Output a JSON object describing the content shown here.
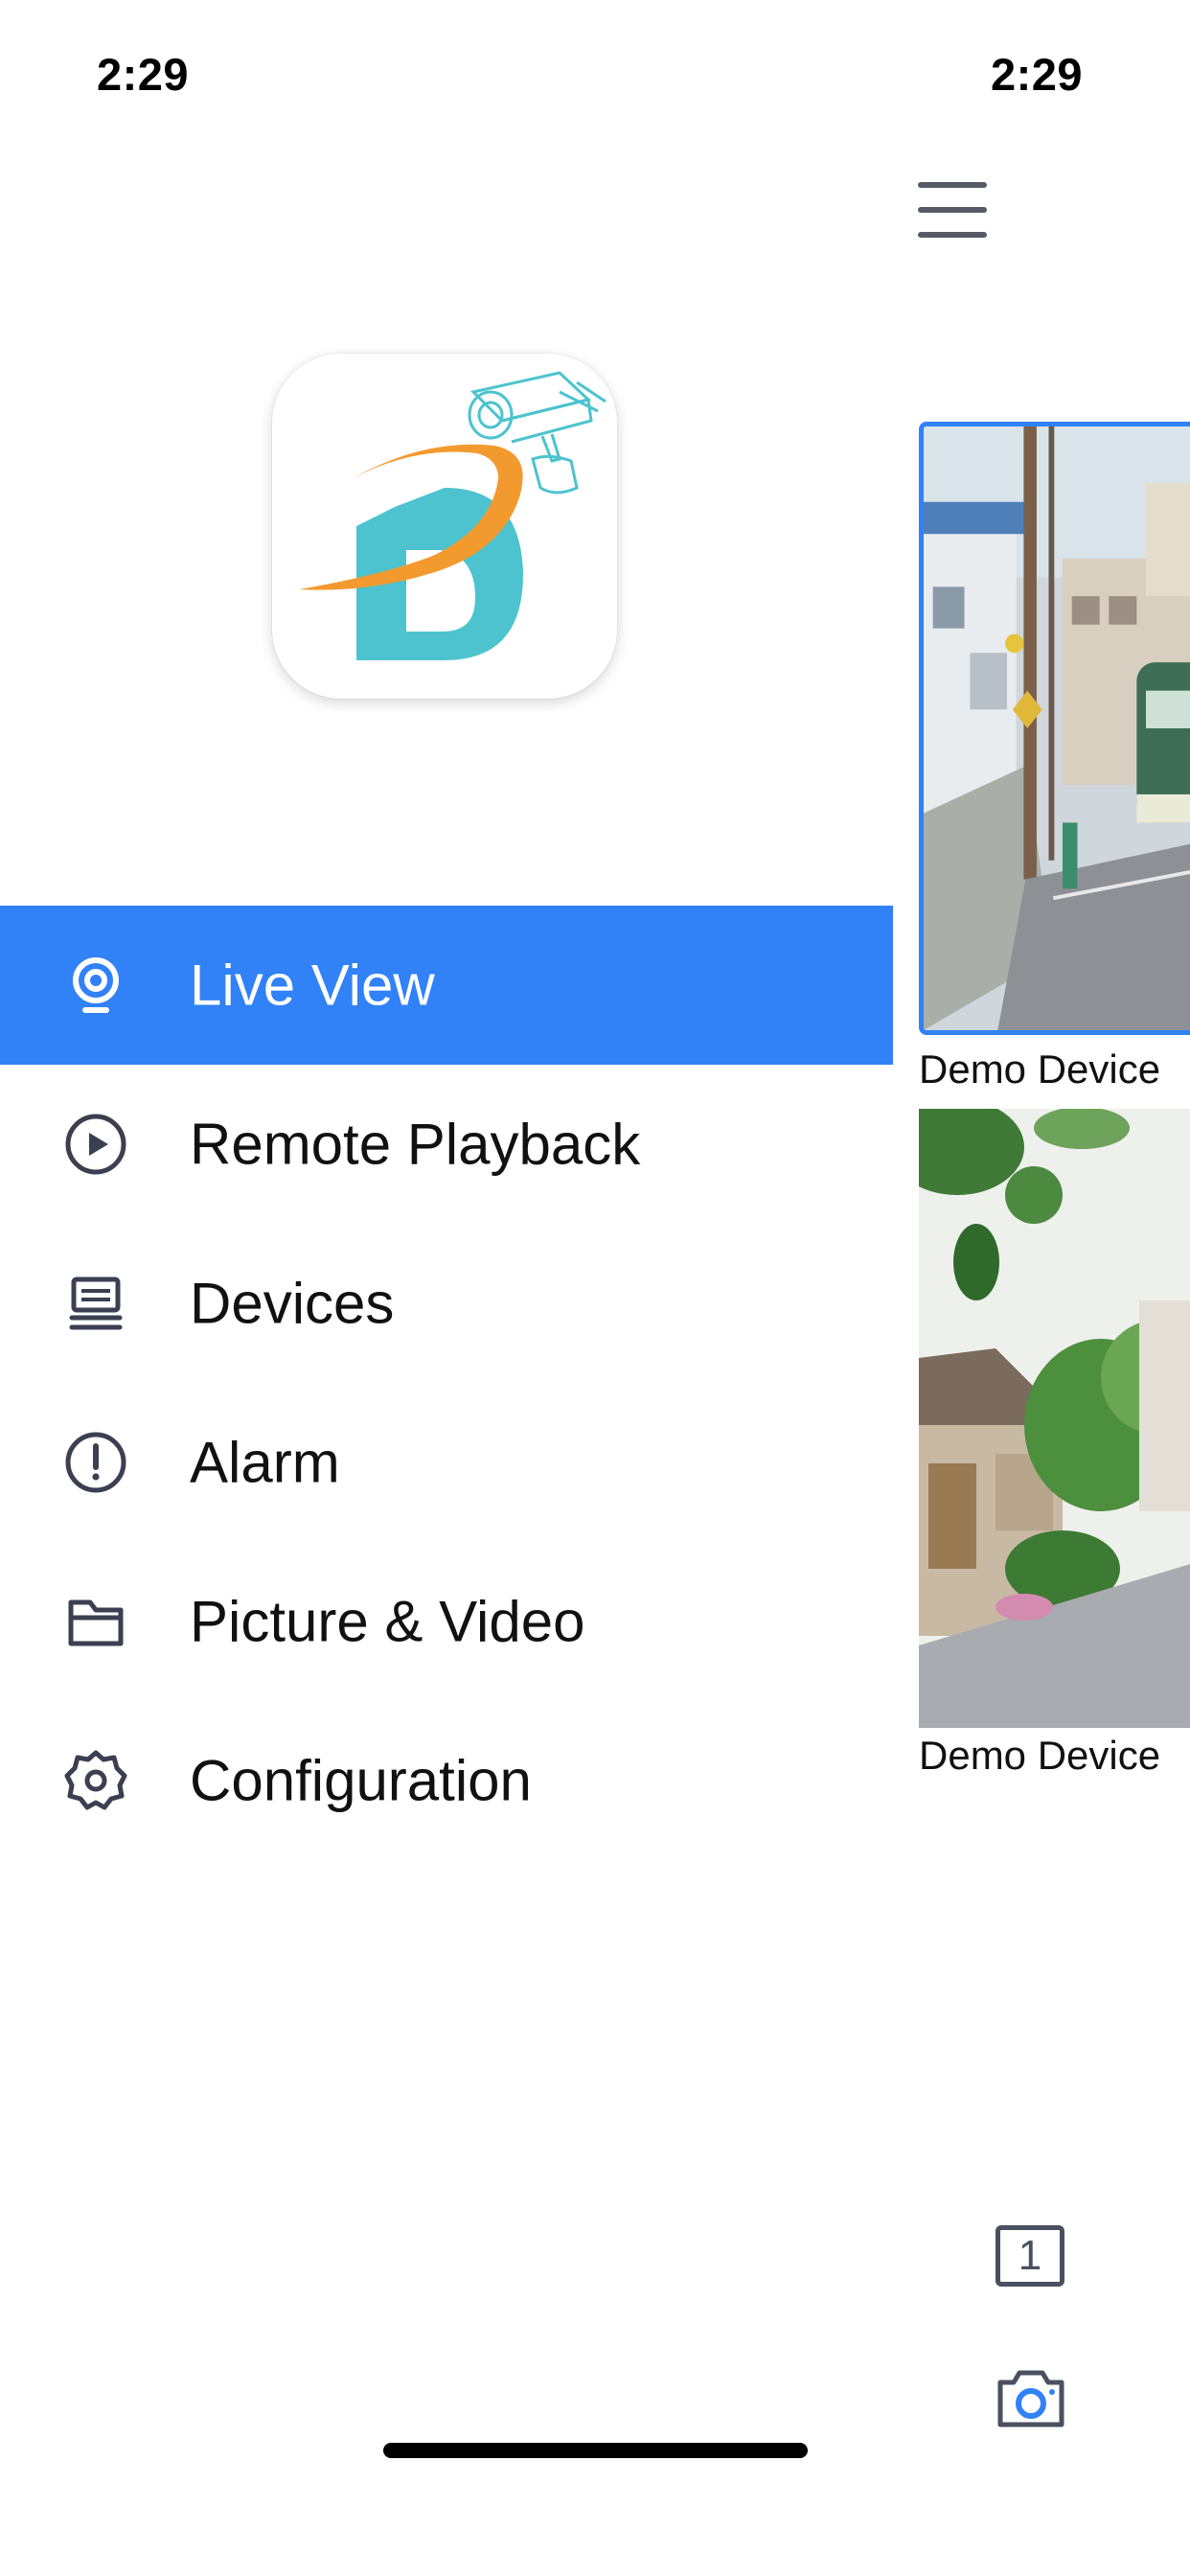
{
  "status": {
    "time_drawer": "2:29",
    "time_main": "2:29"
  },
  "colors": {
    "accent": "#3181F7",
    "logo_orange": "#F39A2E",
    "logo_teal": "#4CC3CF",
    "icon_dark": "#3b3f52"
  },
  "drawer": {
    "logo": "app-logo",
    "menu": [
      {
        "label": "Live View",
        "icon": "camera-lens-icon",
        "active": true
      },
      {
        "label": "Remote Playback",
        "icon": "play-circle-icon",
        "active": false
      },
      {
        "label": "Devices",
        "icon": "device-icon",
        "active": false
      },
      {
        "label": "Alarm",
        "icon": "alert-circle-icon",
        "active": false
      },
      {
        "label": "Picture & Video",
        "icon": "folder-icon",
        "active": false
      },
      {
        "label": "Configuration",
        "icon": "gear-icon",
        "active": false
      }
    ]
  },
  "main": {
    "menu_icon": "hamburger-icon",
    "tiles": [
      {
        "caption": "Demo Device",
        "selected": true
      },
      {
        "caption": "Demo Device",
        "selected": false
      }
    ],
    "split_label": "1",
    "snapshot_icon": "camera-icon"
  }
}
